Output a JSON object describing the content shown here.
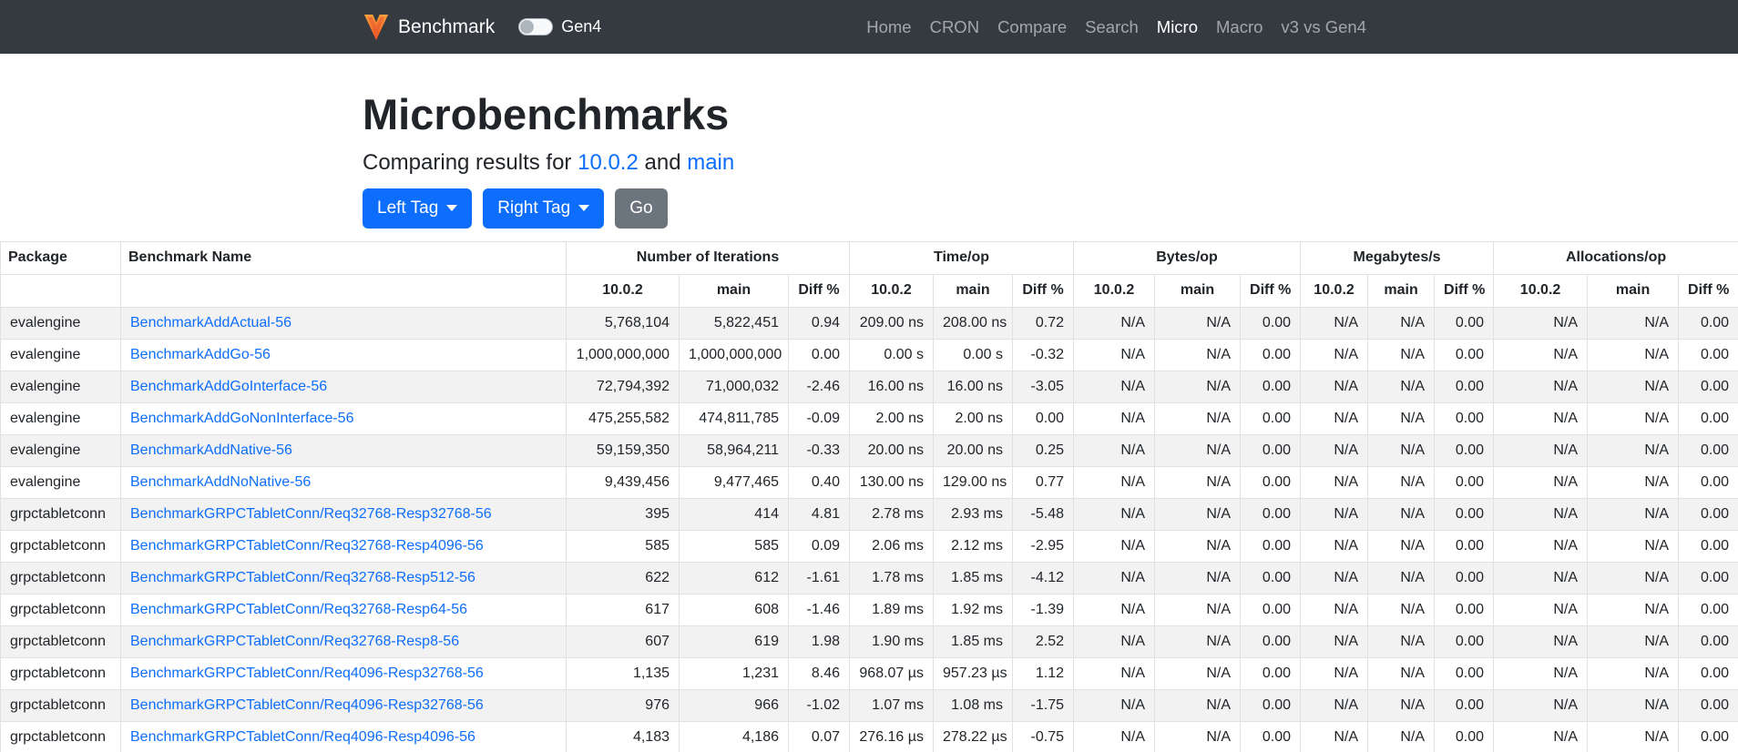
{
  "navbar": {
    "brand": "Benchmark",
    "toggle_label": "Gen4",
    "links": [
      {
        "label": "Home",
        "active": false
      },
      {
        "label": "CRON",
        "active": false
      },
      {
        "label": "Compare",
        "active": false
      },
      {
        "label": "Search",
        "active": false
      },
      {
        "label": "Micro",
        "active": true
      },
      {
        "label": "Macro",
        "active": false
      },
      {
        "label": "v3 vs Gen4",
        "active": false
      }
    ]
  },
  "header": {
    "title": "Microbenchmarks",
    "subtitle_prefix": "Comparing results for ",
    "left_ref": "10.0.2",
    "subtitle_and": " and ",
    "right_ref": "main",
    "buttons": {
      "left_tag": "Left Tag",
      "right_tag": "Right Tag",
      "go": "Go"
    }
  },
  "colors": {
    "navbar_bg": "#343a40",
    "primary_blue": "#0d6efd",
    "secondary_gray": "#6c757d",
    "link_blue": "#0d6efd",
    "row_stripe": "#f2f2f3",
    "table_border": "#dee2e6",
    "logo_orange_light": "#F9A03C",
    "logo_orange_dark": "#F04E23"
  },
  "table": {
    "col_package": "Package",
    "col_name": "Benchmark Name",
    "groups": [
      "Number of Iterations",
      "Time/op",
      "Bytes/op",
      "Megabytes/s",
      "Allocations/op"
    ],
    "sub_headers": [
      "10.0.2",
      "main",
      "Diff %"
    ],
    "rows": [
      {
        "package": "evalengine",
        "name": "BenchmarkAddActual-56",
        "cells": [
          "5,768,104",
          "5,822,451",
          "0.94",
          "209.00 ns",
          "208.00 ns",
          "0.72",
          "N/A",
          "N/A",
          "0.00",
          "N/A",
          "N/A",
          "0.00",
          "N/A",
          "N/A",
          "0.00"
        ]
      },
      {
        "package": "evalengine",
        "name": "BenchmarkAddGo-56",
        "cells": [
          "1,000,000,000",
          "1,000,000,000",
          "0.00",
          "0.00 s",
          "0.00 s",
          "-0.32",
          "N/A",
          "N/A",
          "0.00",
          "N/A",
          "N/A",
          "0.00",
          "N/A",
          "N/A",
          "0.00"
        ]
      },
      {
        "package": "evalengine",
        "name": "BenchmarkAddGoInterface-56",
        "cells": [
          "72,794,392",
          "71,000,032",
          "-2.46",
          "16.00 ns",
          "16.00 ns",
          "-3.05",
          "N/A",
          "N/A",
          "0.00",
          "N/A",
          "N/A",
          "0.00",
          "N/A",
          "N/A",
          "0.00"
        ]
      },
      {
        "package": "evalengine",
        "name": "BenchmarkAddGoNonInterface-56",
        "cells": [
          "475,255,582",
          "474,811,785",
          "-0.09",
          "2.00 ns",
          "2.00 ns",
          "0.00",
          "N/A",
          "N/A",
          "0.00",
          "N/A",
          "N/A",
          "0.00",
          "N/A",
          "N/A",
          "0.00"
        ]
      },
      {
        "package": "evalengine",
        "name": "BenchmarkAddNative-56",
        "cells": [
          "59,159,350",
          "58,964,211",
          "-0.33",
          "20.00 ns",
          "20.00 ns",
          "0.25",
          "N/A",
          "N/A",
          "0.00",
          "N/A",
          "N/A",
          "0.00",
          "N/A",
          "N/A",
          "0.00"
        ]
      },
      {
        "package": "evalengine",
        "name": "BenchmarkAddNoNative-56",
        "cells": [
          "9,439,456",
          "9,477,465",
          "0.40",
          "130.00 ns",
          "129.00 ns",
          "0.77",
          "N/A",
          "N/A",
          "0.00",
          "N/A",
          "N/A",
          "0.00",
          "N/A",
          "N/A",
          "0.00"
        ]
      },
      {
        "package": "grpctabletconn",
        "name": "BenchmarkGRPCTabletConn/Req32768-Resp32768-56",
        "cells": [
          "395",
          "414",
          "4.81",
          "2.78 ms",
          "2.93 ms",
          "-5.48",
          "N/A",
          "N/A",
          "0.00",
          "N/A",
          "N/A",
          "0.00",
          "N/A",
          "N/A",
          "0.00"
        ]
      },
      {
        "package": "grpctabletconn",
        "name": "BenchmarkGRPCTabletConn/Req32768-Resp4096-56",
        "cells": [
          "585",
          "585",
          "0.09",
          "2.06 ms",
          "2.12 ms",
          "-2.95",
          "N/A",
          "N/A",
          "0.00",
          "N/A",
          "N/A",
          "0.00",
          "N/A",
          "N/A",
          "0.00"
        ]
      },
      {
        "package": "grpctabletconn",
        "name": "BenchmarkGRPCTabletConn/Req32768-Resp512-56",
        "cells": [
          "622",
          "612",
          "-1.61",
          "1.78 ms",
          "1.85 ms",
          "-4.12",
          "N/A",
          "N/A",
          "0.00",
          "N/A",
          "N/A",
          "0.00",
          "N/A",
          "N/A",
          "0.00"
        ]
      },
      {
        "package": "grpctabletconn",
        "name": "BenchmarkGRPCTabletConn/Req32768-Resp64-56",
        "cells": [
          "617",
          "608",
          "-1.46",
          "1.89 ms",
          "1.92 ms",
          "-1.39",
          "N/A",
          "N/A",
          "0.00",
          "N/A",
          "N/A",
          "0.00",
          "N/A",
          "N/A",
          "0.00"
        ]
      },
      {
        "package": "grpctabletconn",
        "name": "BenchmarkGRPCTabletConn/Req32768-Resp8-56",
        "cells": [
          "607",
          "619",
          "1.98",
          "1.90 ms",
          "1.85 ms",
          "2.52",
          "N/A",
          "N/A",
          "0.00",
          "N/A",
          "N/A",
          "0.00",
          "N/A",
          "N/A",
          "0.00"
        ]
      },
      {
        "package": "grpctabletconn",
        "name": "BenchmarkGRPCTabletConn/Req4096-Resp32768-56",
        "cells": [
          "1,135",
          "1,231",
          "8.46",
          "968.07 µs",
          "957.23 µs",
          "1.12",
          "N/A",
          "N/A",
          "0.00",
          "N/A",
          "N/A",
          "0.00",
          "N/A",
          "N/A",
          "0.00"
        ]
      },
      {
        "package": "grpctabletconn",
        "name": "BenchmarkGRPCTabletConn/Req4096-Resp32768-56",
        "cells": [
          "976",
          "966",
          "-1.02",
          "1.07 ms",
          "1.08 ms",
          "-1.75",
          "N/A",
          "N/A",
          "0.00",
          "N/A",
          "N/A",
          "0.00",
          "N/A",
          "N/A",
          "0.00"
        ]
      },
      {
        "package": "grpctabletconn",
        "name": "BenchmarkGRPCTabletConn/Req4096-Resp4096-56",
        "cells": [
          "4,183",
          "4,186",
          "0.07",
          "276.16 µs",
          "278.22 µs",
          "-0.75",
          "N/A",
          "N/A",
          "0.00",
          "N/A",
          "N/A",
          "0.00",
          "N/A",
          "N/A",
          "0.00"
        ]
      }
    ]
  }
}
